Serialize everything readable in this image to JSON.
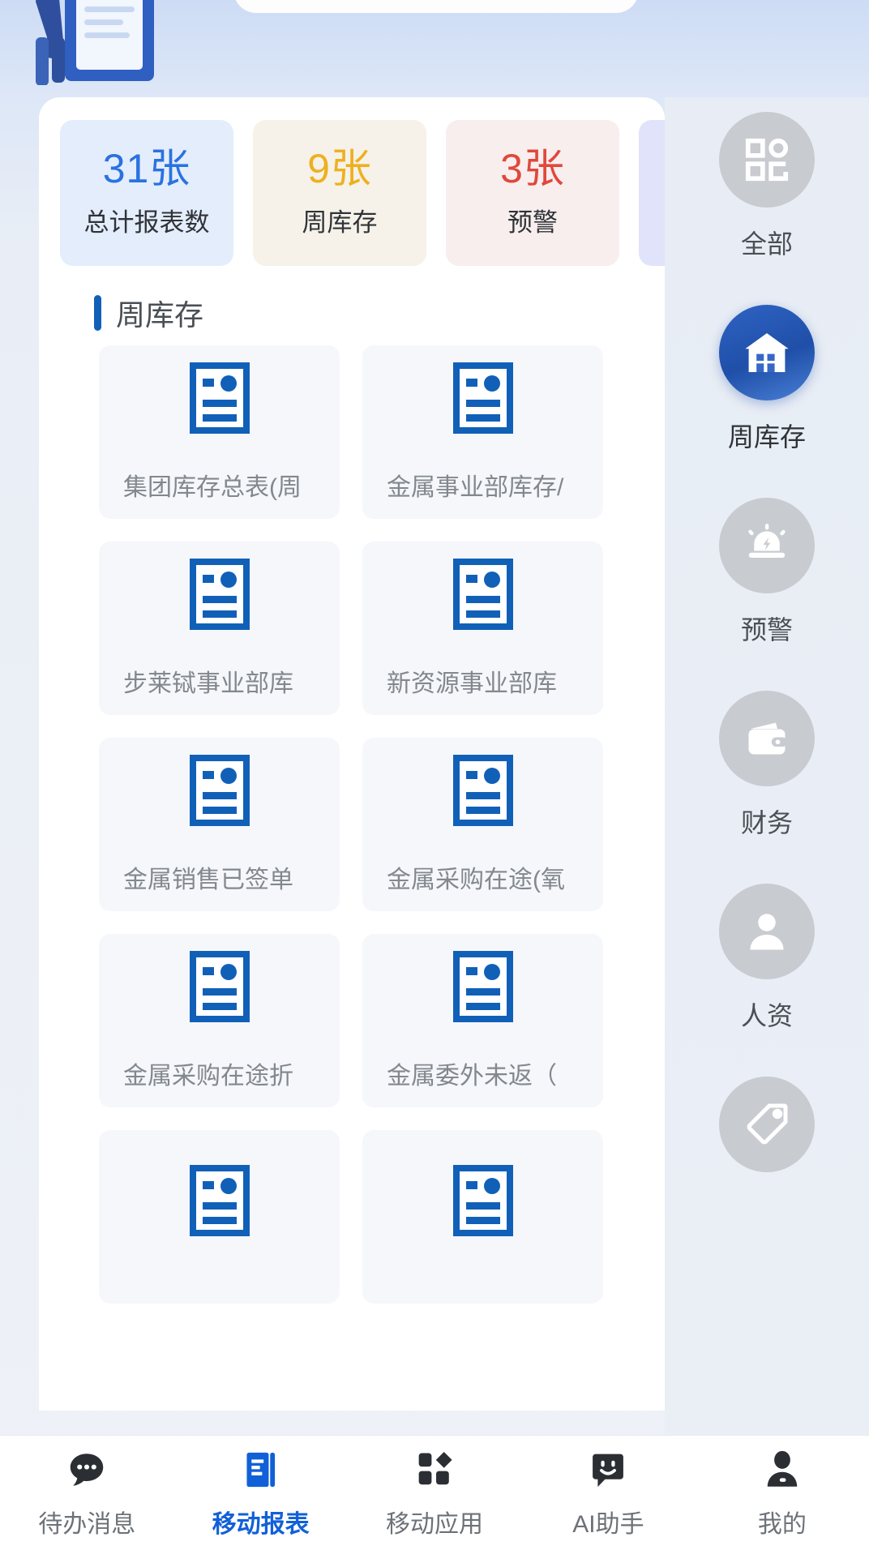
{
  "theme": {
    "accent": "#1160d8",
    "panel_bg": "#ffffff",
    "page_bg": "#e9eef6",
    "card_bg": "#f5f7fa",
    "muted_text": "#83888e"
  },
  "stats": [
    {
      "value": "31张",
      "label": "总计报表数",
      "color": "#2a72e0",
      "bg": "#e4edfb",
      "icon": "stat-card"
    },
    {
      "value": "9张",
      "label": "周库存",
      "color": "#eeb020",
      "bg": "#f6f2e9",
      "icon": "stat-card"
    },
    {
      "value": "3张",
      "label": "预警",
      "color": "#e0483c",
      "bg": "#f7eeed",
      "icon": "stat-card"
    },
    {
      "value": "",
      "label": "",
      "color": "#4d5ae0",
      "bg": "#e0e3fa",
      "icon": "stat-card"
    }
  ],
  "section": {
    "title": "周库存",
    "bar_color": "#1160b8"
  },
  "reports": [
    {
      "label": "集团库存总表(周",
      "icon": "report-doc-icon"
    },
    {
      "label": "金属事业部库存/",
      "icon": "report-doc-icon"
    },
    {
      "label": "步莱铽事业部库",
      "icon": "report-doc-icon"
    },
    {
      "label": "新资源事业部库",
      "icon": "report-doc-icon"
    },
    {
      "label": "金属销售已签单",
      "icon": "report-doc-icon"
    },
    {
      "label": "金属采购在途(氧",
      "icon": "report-doc-icon"
    },
    {
      "label": "金属采购在途折",
      "icon": "report-doc-icon"
    },
    {
      "label": "金属委外未返（",
      "icon": "report-doc-icon"
    },
    {
      "label": "",
      "icon": "report-doc-icon"
    },
    {
      "label": "",
      "icon": "report-doc-icon"
    }
  ],
  "sidebar": {
    "items": [
      {
        "label": "全部",
        "icon": "grid-icon",
        "active": false
      },
      {
        "label": "周库存",
        "icon": "warehouse-icon",
        "active": true
      },
      {
        "label": "预警",
        "icon": "alarm-icon",
        "active": false
      },
      {
        "label": "财务",
        "icon": "wallet-icon",
        "active": false
      },
      {
        "label": "人资",
        "icon": "person-icon",
        "active": false
      },
      {
        "label": "",
        "icon": "tag-icon",
        "active": false
      }
    ]
  },
  "tabbar": {
    "items": [
      {
        "label": "待办消息",
        "icon": "chat-dots-icon",
        "active": false
      },
      {
        "label": "移动报表",
        "icon": "report-book-icon",
        "active": true
      },
      {
        "label": "移动应用",
        "icon": "apps-icon",
        "active": false
      },
      {
        "label": "AI助手",
        "icon": "ai-smile-icon",
        "active": false
      },
      {
        "label": "我的",
        "icon": "user-icon",
        "active": false
      }
    ]
  }
}
